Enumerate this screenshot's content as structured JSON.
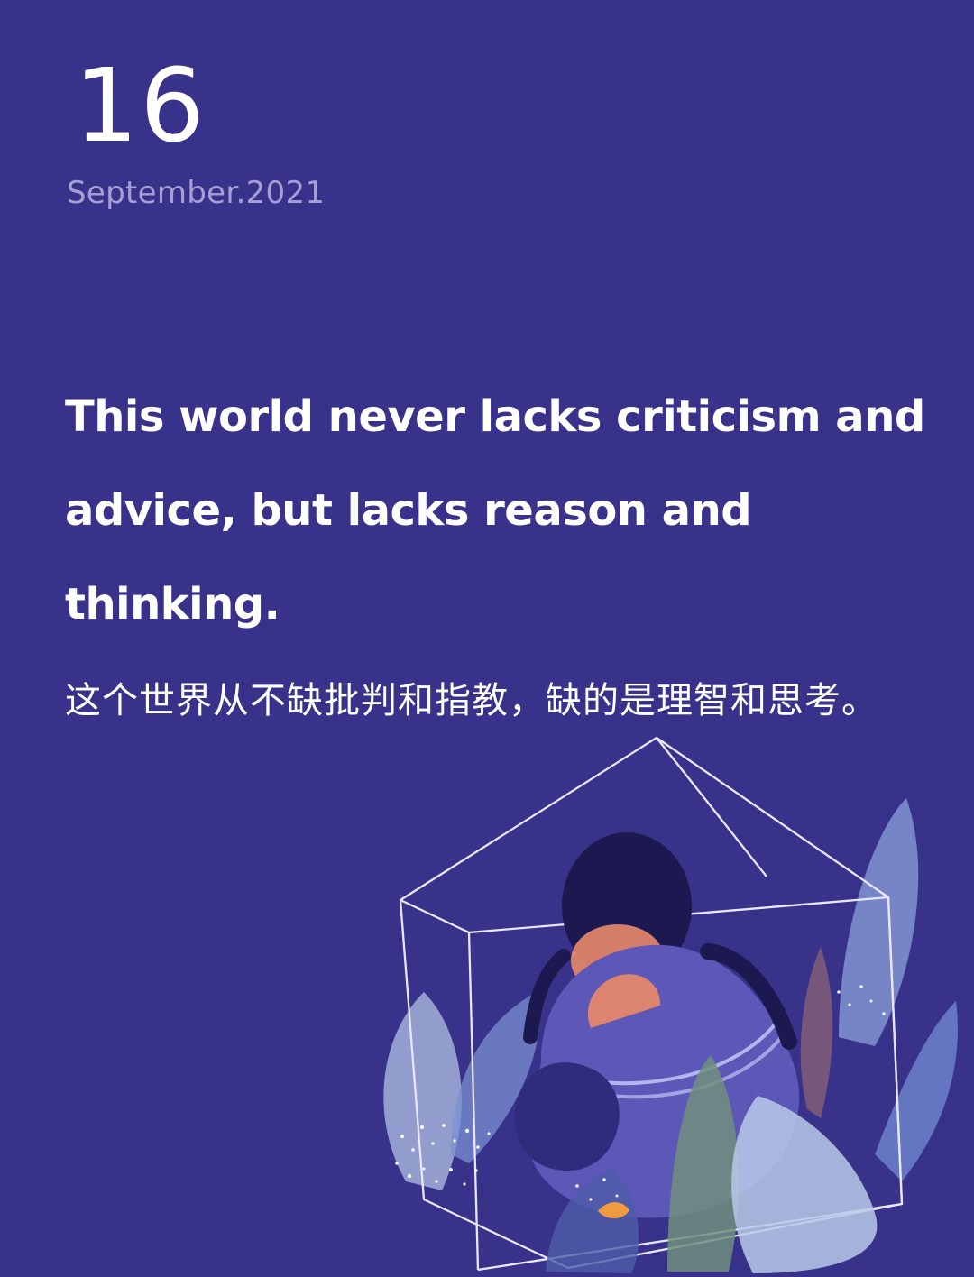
{
  "date": {
    "day": "16",
    "month_year": "September.2021"
  },
  "quote": {
    "en": "This world never lacks criticism and advice, but lacks reason and thinking.",
    "cn": "这个世界从不缺批判和指教，缺的是理智和思考。"
  },
  "illustration": {
    "icon": "girl-in-glass-house-illustration"
  },
  "colors": {
    "background": "#39328a",
    "text": "#ffffff",
    "muted_text": "#a4a0d6",
    "glass_line": "#e9e6ff",
    "foliage_light": "#b8c9e8",
    "foliage_blue": "#6f86cf",
    "foliage_green": "#6f8f7d",
    "skin": "#e4876b",
    "hair": "#1c1950"
  }
}
